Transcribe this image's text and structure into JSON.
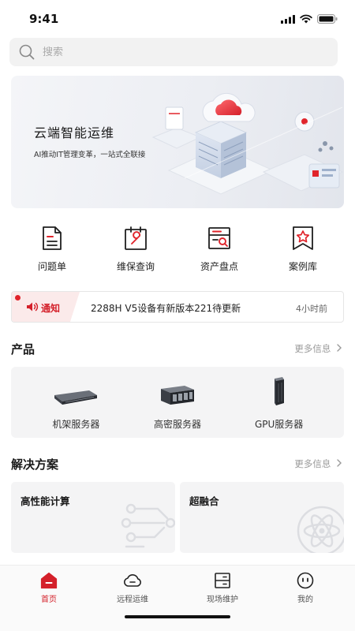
{
  "status_bar": {
    "time": "9:41"
  },
  "search": {
    "placeholder": "搜索",
    "value": ""
  },
  "banner": {
    "title": "云端智能运维",
    "subtitle": "AI推动IT管理变革，一站式全联接"
  },
  "quick_menu": [
    {
      "label": "问题单",
      "icon": "document-icon"
    },
    {
      "label": "维保查询",
      "icon": "calendar-wrench-icon"
    },
    {
      "label": "资产盘点",
      "icon": "server-search-icon"
    },
    {
      "label": "案例库",
      "icon": "bookmark-star-icon"
    }
  ],
  "notice": {
    "tag": "通知",
    "text": "2288H V5设备有新版本221待更新",
    "time": "4小时前"
  },
  "products": {
    "title": "产品",
    "more": "更多信息",
    "items": [
      {
        "label": "机架服务器"
      },
      {
        "label": "高密服务器"
      },
      {
        "label": "GPU服务器"
      }
    ]
  },
  "solutions": {
    "title": "解决方案",
    "more": "更多信息",
    "items": [
      {
        "label": "高性能计算"
      },
      {
        "label": "超融合"
      }
    ]
  },
  "tabbar": {
    "items": [
      {
        "label": "首页",
        "icon": "home-icon",
        "active": true
      },
      {
        "label": "远程运维",
        "icon": "cloud-icon",
        "active": false
      },
      {
        "label": "现场维护",
        "icon": "server-rack-icon",
        "active": false
      },
      {
        "label": "我的",
        "icon": "profile-icon",
        "active": false
      }
    ]
  },
  "colors": {
    "accent": "#d4202a",
    "notice_bg": "#fbeaea",
    "panel_bg": "#f4f4f5",
    "muted_text": "#9a9a9a"
  }
}
